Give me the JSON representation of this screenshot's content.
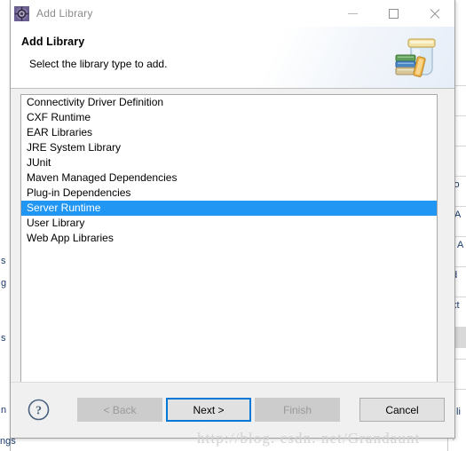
{
  "window": {
    "title": "Add Library",
    "title_icon": "eclipse-gear-icon",
    "minimize_label": "Minimize",
    "maximize_label": "Maximize",
    "close_label": "Close"
  },
  "header": {
    "title": "Add Library",
    "subtitle": "Select the library type to add.",
    "banner_icon": "jar-with-books-icon"
  },
  "list": {
    "items": [
      {
        "label": "Connectivity Driver Definition",
        "selected": false
      },
      {
        "label": "CXF Runtime",
        "selected": false
      },
      {
        "label": "EAR Libraries",
        "selected": false
      },
      {
        "label": "JRE System Library",
        "selected": false
      },
      {
        "label": "JUnit",
        "selected": false
      },
      {
        "label": "Maven Managed Dependencies",
        "selected": false
      },
      {
        "label": "Plug-in Dependencies",
        "selected": false
      },
      {
        "label": "Server Runtime",
        "selected": true
      },
      {
        "label": "User Library",
        "selected": false
      },
      {
        "label": "Web App Libraries",
        "selected": false
      }
    ],
    "selected_label": "Server Runtime",
    "selection_color": "#2196f3"
  },
  "footer": {
    "help_icon": "question-mark-circle-icon",
    "buttons": [
      {
        "label": "< Back",
        "state": "disabled"
      },
      {
        "label": "Next >",
        "state": "default"
      },
      {
        "label": "Finish",
        "state": "disabled"
      },
      {
        "label": "Cancel",
        "state": "normal"
      }
    ]
  },
  "watermark": {
    "text": "http://blog. csdn. net/Grandaunt"
  },
  "background": {
    "left_fragments": [
      "s",
      "g",
      "s",
      "n",
      "ngs"
    ],
    "right_fragments": [
      "lo",
      "A",
      "A",
      "d",
      "xt",
      "li",
      "t"
    ]
  },
  "colors": {
    "accent": "#0078d7",
    "selection": "#2196f3",
    "dialog_bg": "#f0f0f0",
    "list_bg": "#ffffff"
  }
}
